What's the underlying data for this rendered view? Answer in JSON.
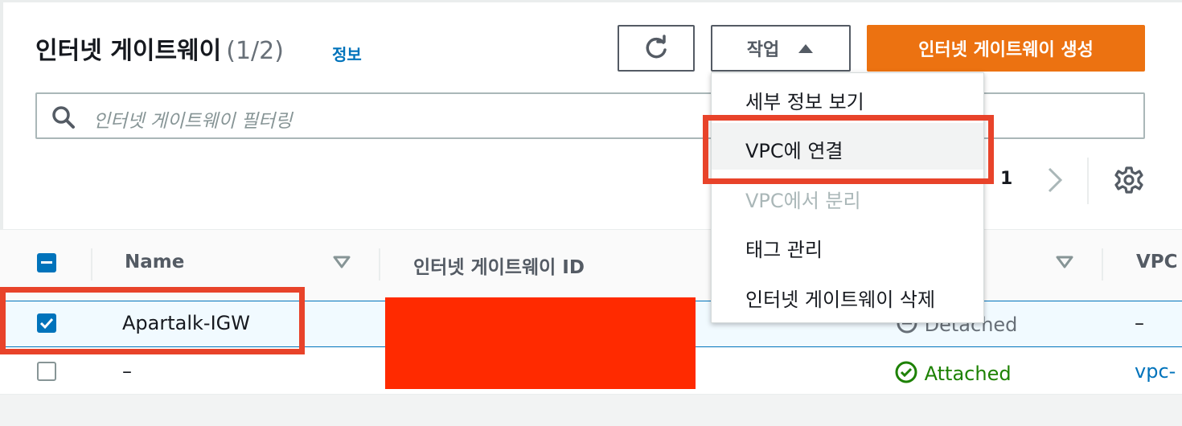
{
  "header": {
    "title": "인터넷 게이트웨이",
    "count": "(1/2)",
    "info_link": "정보",
    "actions_label": "작업",
    "create_label": "인터넷 게이트웨이 생성"
  },
  "search": {
    "placeholder": "인터넷 게이트웨이 필터링"
  },
  "pagination": {
    "current_page": "1"
  },
  "table": {
    "columns": [
      "Name",
      "인터넷 게이트웨이 ID",
      "VPC"
    ],
    "rows": [
      {
        "name": "Apartalk-IGW",
        "state": "Detached",
        "vpc": "–",
        "selected": true
      },
      {
        "name": "–",
        "state": "Attached",
        "vpc": "vpc-",
        "selected": false
      }
    ]
  },
  "actions_menu": {
    "items": [
      {
        "label": "세부 정보 보기",
        "disabled": false
      },
      {
        "label": "VPC에 연결",
        "disabled": false
      },
      {
        "label": "VPC에서 분리",
        "disabled": true
      },
      {
        "label": "태그 관리",
        "disabled": false
      },
      {
        "label": "인터넷 게이트웨이 삭제",
        "disabled": false
      }
    ]
  },
  "icons": {
    "refresh": "refresh-icon",
    "caret": "caret-up-icon",
    "search": "search-icon",
    "next": "chevron-right-icon",
    "settings": "gear-icon",
    "sort": "sort-down-icon",
    "attached": "check-circle-icon"
  },
  "colors": {
    "primary": "#ec7211",
    "link": "#0073bb",
    "success": "#1d8102",
    "annotation": "#e8432a",
    "redaction": "#ff2a00"
  }
}
